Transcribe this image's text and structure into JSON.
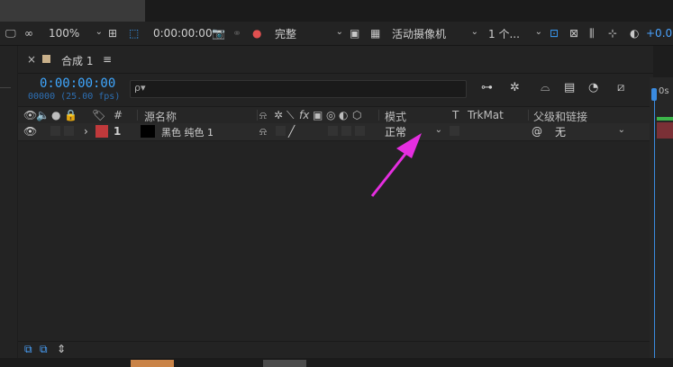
{
  "viewer_toolbar": {
    "zoom": "100%",
    "timecode": "0:00:00:00",
    "resolution": "完整",
    "camera": "活动摄像机",
    "views": "1 个...",
    "exposure": "+0.0"
  },
  "panel": {
    "tab_title": "合成 1",
    "close_glyph": "×",
    "menu_glyph": "≡",
    "timecode": "0:00:00:00",
    "fps": "00000 (25.00 fps)"
  },
  "search": {
    "icon": "ρ▾",
    "placeholder": ""
  },
  "columns": {
    "index": "#",
    "source_name": "源名称",
    "fx": "fx",
    "mode": "模式",
    "t": "T",
    "trkmat": "TrkMat",
    "parent": "父级和链接"
  },
  "layer": {
    "index": "1",
    "name": "黑色 纯色 1",
    "mode": "正常",
    "parent": "无"
  },
  "timeline": {
    "time_label": "0s"
  },
  "colors": {
    "label_red": "#c0393b",
    "timecode_blue": "#3fa7ff",
    "arrow_magenta": "#e52ee0",
    "cti_blue": "#3a8be0",
    "orange": "#c98347"
  }
}
